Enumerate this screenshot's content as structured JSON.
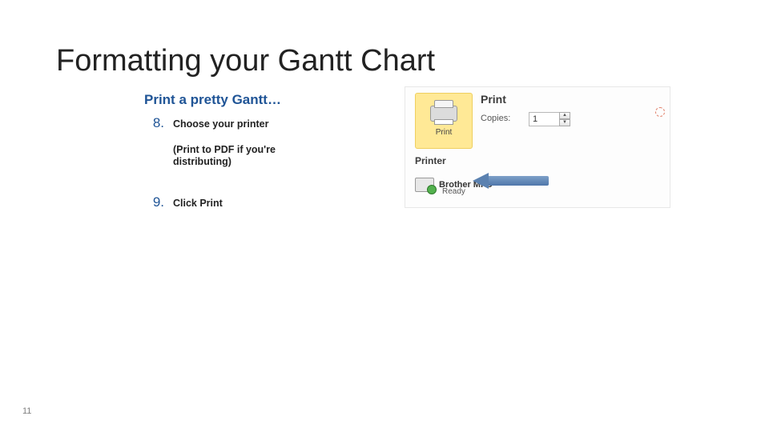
{
  "title": "Formatting your Gantt Chart",
  "subtitle": "Print a pretty Gantt…",
  "steps": {
    "n8": "8.",
    "t8": "Choose your printer",
    "note8": "(Print to PDF if you're distributing)",
    "n9": "9.",
    "t9": "Click Print"
  },
  "dialog": {
    "print_heading": "Print",
    "print_btn": "Print",
    "copies_label": "Copies:",
    "copies_value": "1",
    "printer_heading": "Printer",
    "printer_name": "Brother MFC",
    "printer_status": "Ready"
  },
  "page_number": "11"
}
